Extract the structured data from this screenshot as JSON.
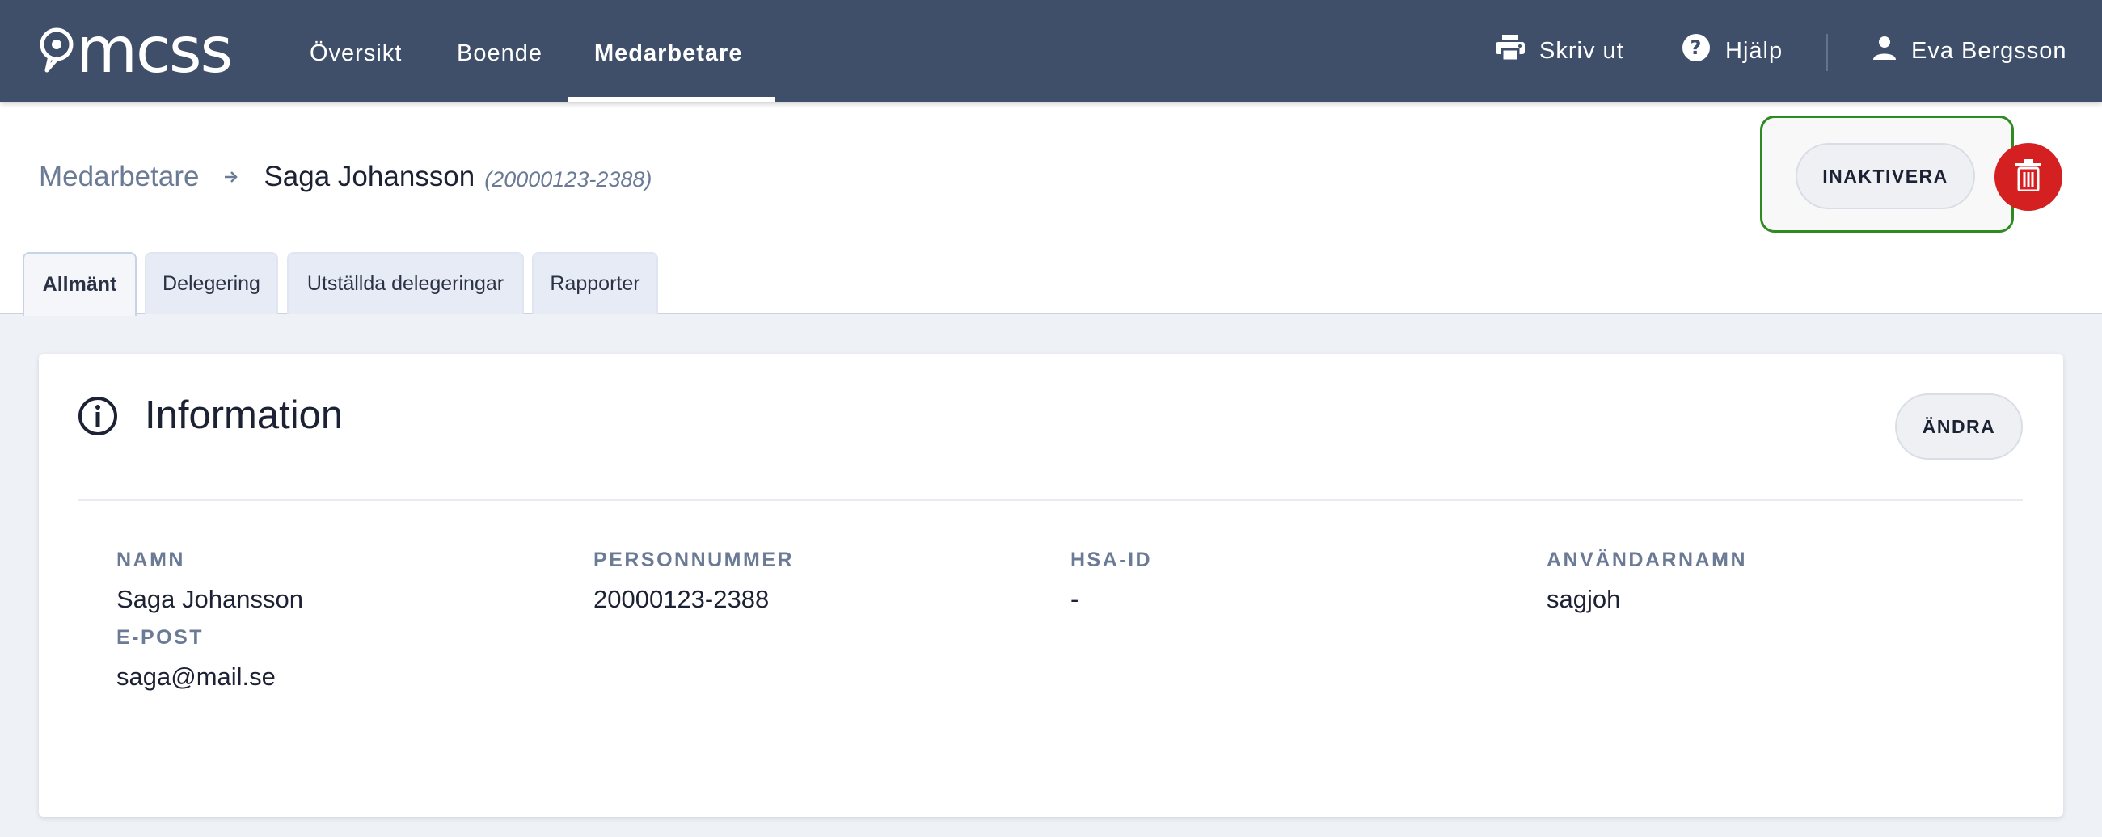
{
  "brand": {
    "logo_text": "mcss"
  },
  "nav": {
    "items": [
      {
        "label": "Översikt"
      },
      {
        "label": "Boende"
      },
      {
        "label": "Medarbetare"
      }
    ],
    "active_index": 2
  },
  "top_actions": {
    "print_label": "Skriv ut",
    "help_label": "Hjälp",
    "user_name": "Eva Bergsson"
  },
  "breadcrumb": {
    "parent": "Medarbetare",
    "current": "Saga Johansson",
    "current_id": "(20000123-2388)"
  },
  "header_actions": {
    "deactivate_label": "INAKTIVERA",
    "delete_icon": "trash-icon",
    "delete_color": "#d42020",
    "highlight_color": "#2e8b22"
  },
  "tabs": [
    {
      "label": "Allmänt"
    },
    {
      "label": "Delegering"
    },
    {
      "label": "Utställda delegeringar"
    },
    {
      "label": "Rapporter"
    }
  ],
  "active_tab": 0,
  "info_card": {
    "title": "Information",
    "edit_label": "ÄNDRA",
    "fields": {
      "name": {
        "label": "NAMN",
        "value": "Saga Johansson"
      },
      "personnummer": {
        "label": "PERSONNUMMER",
        "value": "20000123-2388"
      },
      "hsa_id": {
        "label": "HSA-ID",
        "value": "-"
      },
      "username": {
        "label": "ANVÄNDARNAMN",
        "value": "sagjoh"
      },
      "email": {
        "label": "E-POST",
        "value": "saga@mail.se"
      }
    }
  },
  "colors": {
    "topbar": "#3f4f6a",
    "page_bg": "#eef1f6",
    "muted_text": "#6b7a95"
  }
}
